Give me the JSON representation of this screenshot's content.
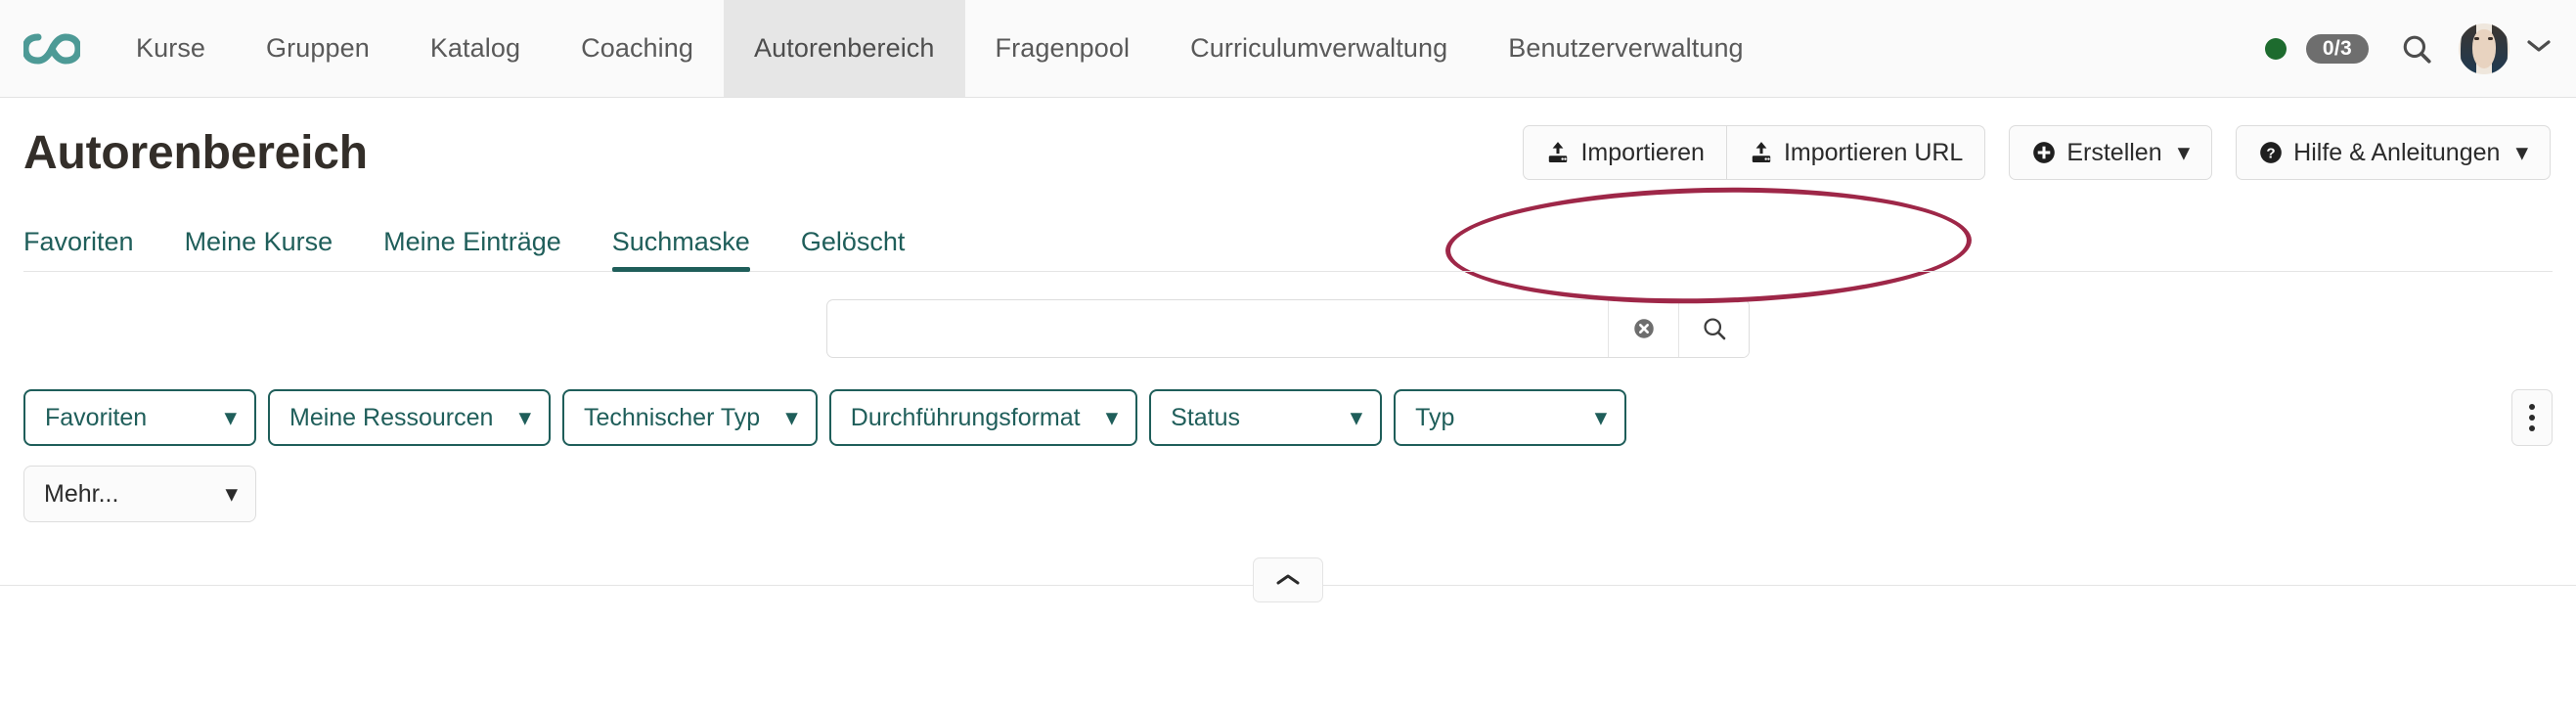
{
  "navbar": {
    "logo_icon": "infinity-logo",
    "logo_color": "#4d9a96",
    "items": [
      {
        "label": "Kurse",
        "active": false
      },
      {
        "label": "Gruppen",
        "active": false
      },
      {
        "label": "Katalog",
        "active": false
      },
      {
        "label": "Coaching",
        "active": false
      },
      {
        "label": "Autorenbereich",
        "active": true
      },
      {
        "label": "Fragenpool",
        "active": false
      },
      {
        "label": "Curriculumverwaltung",
        "active": false
      },
      {
        "label": "Benutzerverwaltung",
        "active": false
      }
    ],
    "status_dot_color": "#1d6b2e",
    "count_badge": "0/3",
    "search_icon": "search-icon",
    "avatar_icon": "user-avatar",
    "user_menu_caret": "chevron-down-icon"
  },
  "header": {
    "title": "Autorenbereich",
    "buttons": {
      "import": {
        "label": "Importieren",
        "icon": "upload-icon"
      },
      "import_url": {
        "label": "Importieren URL",
        "icon": "upload-icon"
      },
      "create": {
        "label": "Erstellen",
        "icon": "plus-circle-icon",
        "caret": "▾"
      },
      "help": {
        "label": "Hilfe & Anleitungen",
        "icon": "question-circle-icon",
        "caret": "▾"
      }
    },
    "highlight": {
      "shape": "ellipse",
      "color": "#9e2748",
      "targets": "Importieren / Importieren URL"
    }
  },
  "tabs": [
    {
      "label": "Favoriten",
      "active": false
    },
    {
      "label": "Meine Kurse",
      "active": false
    },
    {
      "label": "Meine Einträge",
      "active": false
    },
    {
      "label": "Suchmaske",
      "active": true
    },
    {
      "label": "Gelöscht",
      "active": false
    }
  ],
  "search": {
    "value": "",
    "placeholder": "",
    "clear_icon": "clear-circle-icon",
    "search_icon": "search-icon"
  },
  "filters": {
    "row1": [
      {
        "label": "Favoriten",
        "style": "accent"
      },
      {
        "label": "Meine Ressourcen",
        "style": "accent"
      },
      {
        "label": "Technischer Typ",
        "style": "accent"
      },
      {
        "label": "Durchführungsformat",
        "style": "accent"
      },
      {
        "label": "Status",
        "style": "accent"
      },
      {
        "label": "Typ",
        "style": "accent"
      }
    ],
    "row2": [
      {
        "label": "Mehr...",
        "style": "plain"
      }
    ],
    "caret": "▾",
    "kebab_icon": "more-vertical-icon",
    "accent_color": "#1f5e5a"
  },
  "collapse": {
    "icon": "chevron-up-icon"
  }
}
